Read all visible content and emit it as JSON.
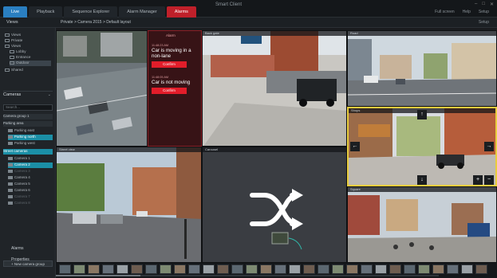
{
  "app": {
    "title": "Smart Client",
    "tabs": [
      {
        "label": "Live",
        "state": "active"
      },
      {
        "label": "Playback",
        "state": "normal"
      },
      {
        "label": "Sequence Explorer",
        "state": "normal"
      },
      {
        "label": "Alarm Manager",
        "state": "normal"
      },
      {
        "label": "Alarms",
        "state": "alarm"
      }
    ],
    "top_right": [
      "Full screen",
      "Help",
      "Setup"
    ],
    "window_controls": [
      "–",
      "□",
      "✕"
    ]
  },
  "toolbar": {
    "views_label": "Views",
    "breadcrumb": "Private > Camera 2015 > Default layout",
    "right_label": "Setup"
  },
  "sidebar": {
    "tree": [
      {
        "label": "Views",
        "style": "normal"
      },
      {
        "label": "Private",
        "style": "normal"
      },
      {
        "label": "Views",
        "style": "normal"
      },
      {
        "label": "Lobby",
        "style": "normal"
      },
      {
        "label": "Entrance",
        "style": "normal"
      },
      {
        "label": "Outdoor",
        "style": "hl"
      },
      {
        "label": "Shared",
        "style": "normal"
      }
    ],
    "cameras_header": "Cameras",
    "search_placeholder": "Search...",
    "groups": [
      {
        "label": "Camera group 1",
        "style": "normal"
      },
      {
        "label": "Parking area",
        "style": "normal"
      }
    ],
    "cameras_a": [
      {
        "label": "Parking east",
        "style": "normal"
      },
      {
        "label": "Parking north",
        "style": "cyan"
      },
      {
        "label": "Parking west",
        "style": "normal"
      }
    ],
    "group_c": {
      "label": "Street cameras",
      "style": "cyan"
    },
    "cameras_b": [
      {
        "label": "Camera 1",
        "style": "normal"
      },
      {
        "label": "Camera 2",
        "style": "cyan"
      },
      {
        "label": "Camera 3",
        "style": "dim"
      },
      {
        "label": "Camera 4",
        "style": "normal"
      },
      {
        "label": "Camera 5",
        "style": "normal"
      },
      {
        "label": "Camera 6",
        "style": "normal"
      },
      {
        "label": "Camera 7",
        "style": "dim"
      },
      {
        "label": "Camera 8",
        "style": "dim"
      }
    ],
    "new_group_label": "+ New camera group",
    "footer_items": [
      "Alarms",
      "Properties"
    ]
  },
  "tiles": {
    "t1": "Parking lot",
    "t2": "Back gate",
    "t3": "Road",
    "t4": "Shops",
    "t5": "Street view",
    "t6": "Carousel",
    "t7": "Square"
  },
  "alarm_panel": {
    "header": "Alarm",
    "alarms": [
      {
        "time": "11:48:23 AM",
        "message": "Car is moving in a non-lane",
        "button": "Confirm"
      },
      {
        "time": "11:48:05 AM",
        "message": "Car is not moving",
        "button": "Confirm"
      }
    ]
  },
  "ptz": {
    "up": "↑",
    "left": "←",
    "right": "→",
    "down": "↓",
    "close": "✕",
    "zoom_in": "+",
    "zoom_out": "−"
  },
  "filmstrip": {
    "thumb_count": 30,
    "progress": 0.22
  },
  "colors": {
    "accent": "#2a7fc1",
    "alarm_red": "#e21d2a",
    "highlight_cyan": "#1b8fa6",
    "ptz_frame": "#e8cd3f"
  }
}
